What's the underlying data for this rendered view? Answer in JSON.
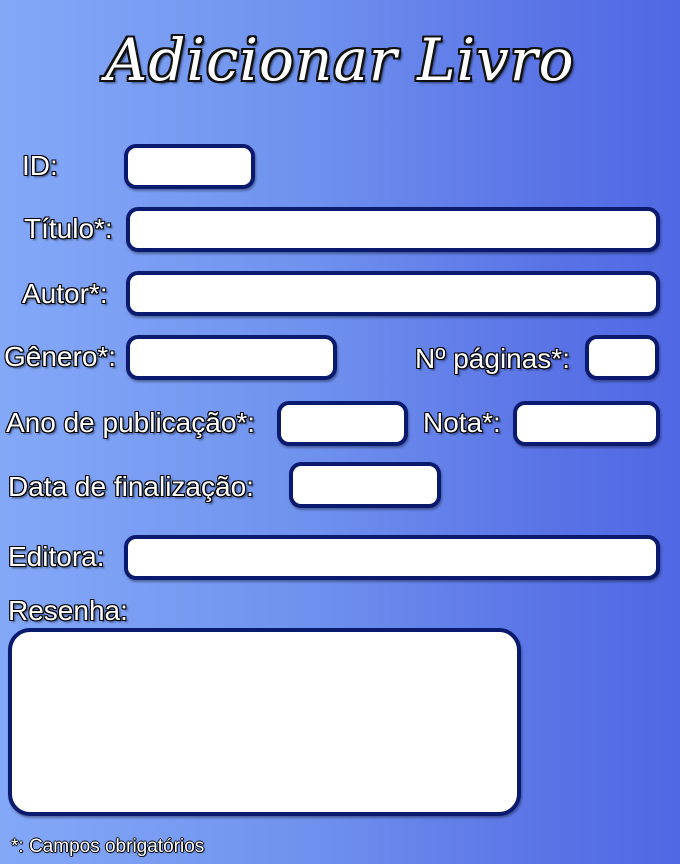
{
  "title": "Adicionar Livro",
  "fields": {
    "id": {
      "label": "ID:",
      "value": ""
    },
    "titulo": {
      "label": "Título*:",
      "value": ""
    },
    "autor": {
      "label": "Autor*:",
      "value": ""
    },
    "genero": {
      "label": "Gênero*:",
      "value": ""
    },
    "paginas": {
      "label": "Nº páginas*:",
      "value": ""
    },
    "ano": {
      "label": "Ano de publicação*:",
      "value": ""
    },
    "nota": {
      "label": "Nota*:",
      "value": ""
    },
    "finalizacao": {
      "label": "Data de finalização:",
      "value": ""
    },
    "editora": {
      "label": "Editora:",
      "value": ""
    },
    "resenha": {
      "label": "Resenha:",
      "value": ""
    }
  },
  "footnote": "*: Campos obrigatórios",
  "colors": {
    "field_border": "#0a1a6e",
    "background_left": "#84a8f8",
    "background_right": "#5068e4"
  }
}
